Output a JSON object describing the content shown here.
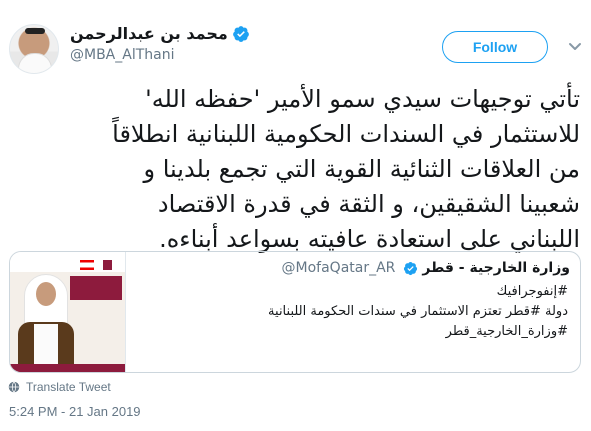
{
  "author": {
    "display_name": "محمد بن عبدالرحمن",
    "handle": "@MBA_AlThani",
    "verified": true
  },
  "follow_label": "Follow",
  "tweet": {
    "lines": [
      "تأتي توجيهات سيدي سمو الأمير 'حفظه الله'",
      "للاستثمار في السندات الحكومية اللبنانية انطلاقاً",
      "من العلاقات الثنائية القوية التي تجمع بلدينا و",
      "شعبينا الشقيقين، و الثقة في قدرة الاقتصاد",
      "اللبناني على استعادة عافيته بسواعد أبناءه."
    ]
  },
  "quoted_tweet": {
    "name": "وزارة الخارجية - قطر",
    "handle": "@MofaQatar_AR",
    "verified": true,
    "lines": [
      "#إنفوجرافيك",
      "دولة #قطر تعتزم الاستثمار في سندات الحكومة اللبنانية",
      "#وزارة_الخارجية_قطر"
    ]
  },
  "translate_label": "Translate Tweet",
  "timestamp": "5:24 PM - 21 Jan 2019",
  "colors": {
    "accent": "#1da1f2",
    "text": "#14171a",
    "secondary": "#657786",
    "border": "#ccd6dd"
  },
  "icons": {
    "verified": "verified-badge-icon",
    "caret": "chevron-down-icon",
    "translate": "globe-icon"
  }
}
